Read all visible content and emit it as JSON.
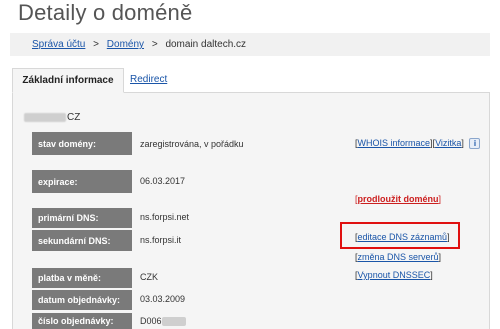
{
  "page": {
    "title": "Detaily o doméně"
  },
  "breadcrumb": {
    "items": [
      {
        "label": "Správa účtu",
        "link": true
      },
      {
        "label": "Domény",
        "link": true
      },
      {
        "label": "domain daltech.cz",
        "link": false
      }
    ],
    "separator": ">"
  },
  "tabs": [
    {
      "label": "Základní informace",
      "active": true
    },
    {
      "label": "Redirect",
      "active": false
    }
  ],
  "domain": {
    "suffix": "CZ"
  },
  "rows": {
    "status": {
      "label": "stav domény:",
      "value": "zaregistrována, v pořádku"
    },
    "expiration": {
      "label": "expirace:",
      "value": "06.03.2017"
    },
    "primary_dns": {
      "label": "primární DNS:",
      "value": "ns.forpsi.net"
    },
    "secondary_dns": {
      "label": "sekundární DNS:",
      "value": "ns.forpsi.it"
    },
    "currency": {
      "label": "platba v měně:",
      "value": "CZK"
    },
    "order_date": {
      "label": "datum objednávky:",
      "value": "03.03.2009"
    },
    "order_number": {
      "label": "číslo objednávky:",
      "value": "D006"
    }
  },
  "actions": {
    "bracket_open": "[",
    "bracket_close": "]",
    "whois": "WHOIS informace",
    "vizitka": "Vizitka",
    "prodlouzit": "prodloužit doménu",
    "editace_dns": "editace DNS záznamů",
    "zmena_dns": "změna DNS serverů",
    "vypnout_dnssec": "Vypnout DNSSEC"
  },
  "icons": {
    "info": "i"
  },
  "colors": {
    "link": "#1a55a8",
    "danger": "#cc1f1f",
    "highlight": "#e01010",
    "label_bg": "#7a7a7a"
  }
}
